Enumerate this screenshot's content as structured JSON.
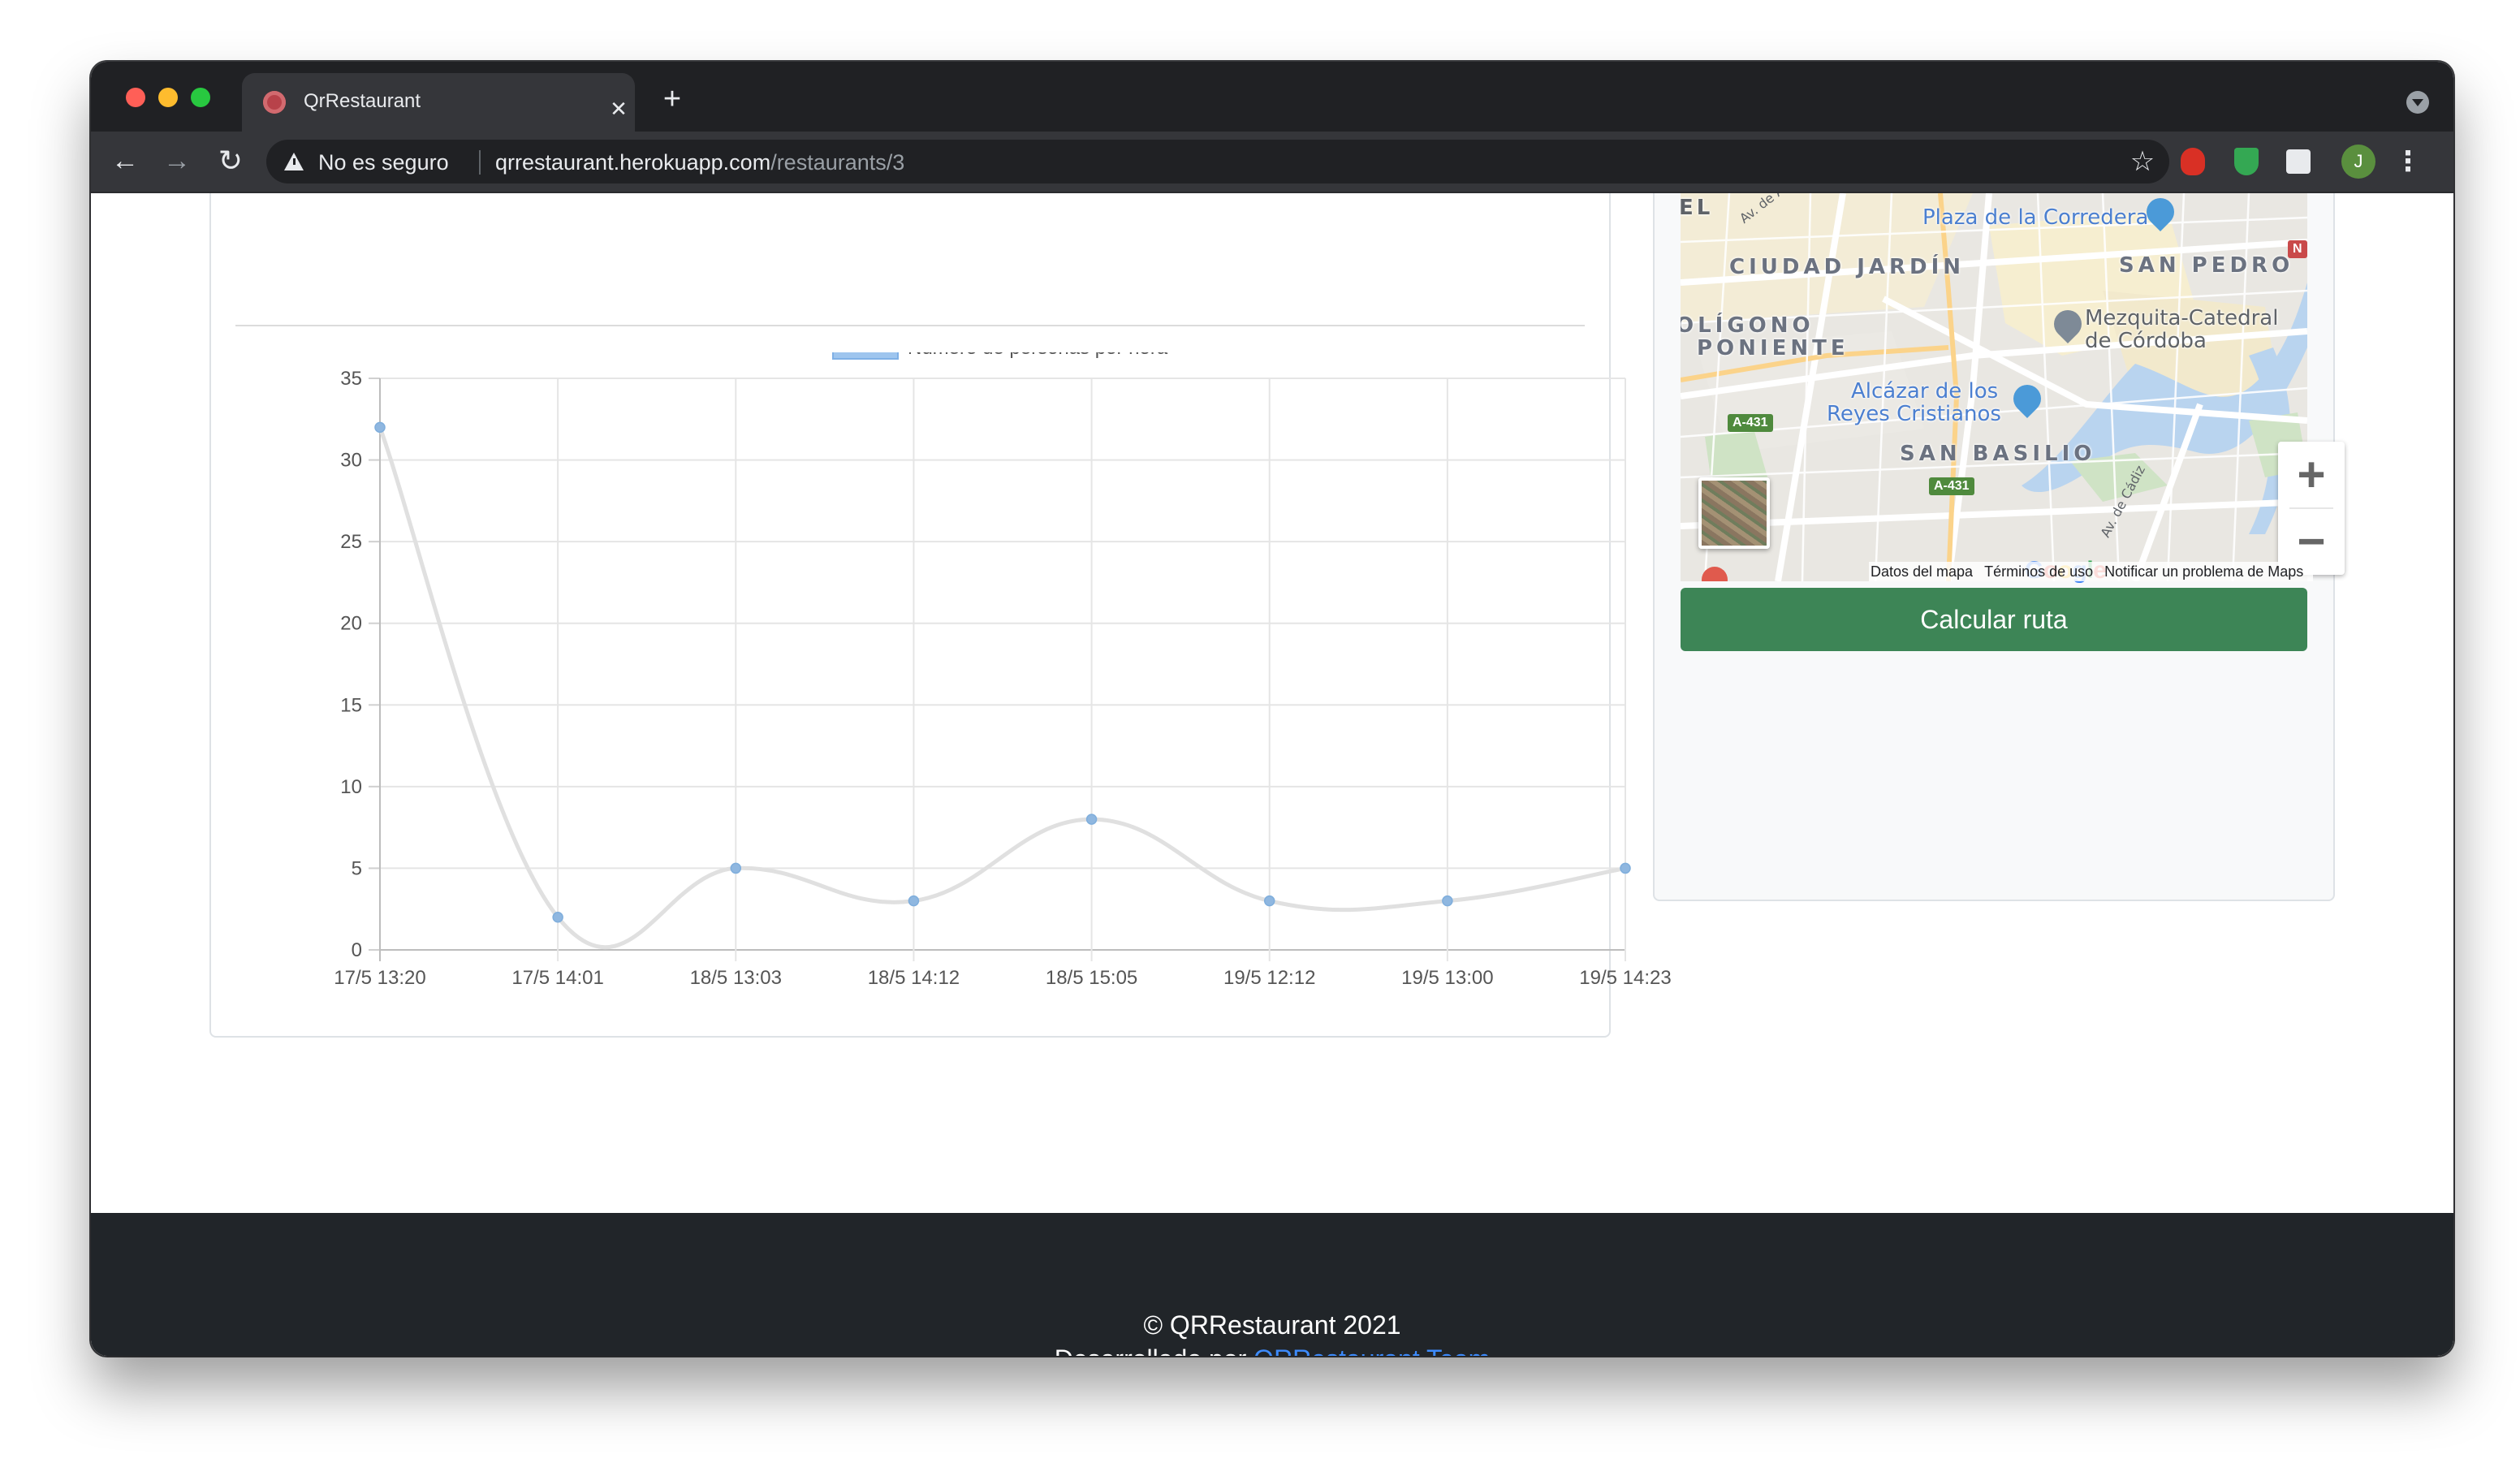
{
  "browser": {
    "tab_title": "QrRestaurant",
    "tab_close": "✕",
    "new_tab": "+",
    "insecure_label": "No es seguro",
    "url_host": "qrrestaurant.herokuapp.com",
    "url_path": "/restaurants/3",
    "avatar_initial": "J",
    "icons": [
      "back-icon",
      "forward-icon",
      "reload-icon",
      "warning-icon",
      "star-icon",
      "extensions-icon",
      "menu-icon"
    ]
  },
  "chart_data": {
    "type": "line",
    "legend_label": "Número de personas por hora",
    "legend_position": "top",
    "categories": [
      "17/5 13:20",
      "17/5 14:01",
      "18/5 13:03",
      "18/5 14:12",
      "18/5 15:05",
      "19/5 12:12",
      "19/5 13:00",
      "19/5 14:23"
    ],
    "series": [
      {
        "name": "Número de personas por hora",
        "values": [
          32,
          2,
          5,
          3,
          8,
          3,
          3,
          5
        ]
      }
    ],
    "ylim": [
      0,
      35
    ],
    "yticks": [
      0,
      5,
      10,
      15,
      20,
      25,
      30,
      35
    ],
    "grid": true,
    "line_color": "#e0e0e0",
    "point_color": "#8fb7e0",
    "legend_fill": "#9ec5ee"
  },
  "map": {
    "labels": {
      "plaza": "Plaza de la Corredera",
      "ciudad_jardin": "CIUDAD JARDÍN",
      "san_pedro": "SAN PEDRO",
      "poligono_1": "OLÍGONO",
      "poligono_2": "PONIENTE",
      "mezquita_1": "Mezquita-Catedral",
      "mezquita_2": "de Córdoba",
      "alcazar_1": "Alcázar de los",
      "alcazar_2": "Reyes Cristianos",
      "san_basilio": "SAN BASILIO",
      "el": "EL",
      "road_1": "A-431",
      "road_2": "A-431",
      "av_cadiz": "Av. de Cádiz",
      "av_top": "Av. de A",
      "north_badge": "N"
    },
    "zoom_in": "+",
    "zoom_out": "−",
    "attribution": [
      "Datos del mapa",
      "Términos de uso",
      "Notificar un problema de Maps"
    ]
  },
  "route_button": "Calcular ruta",
  "footer": {
    "copyright": "© QRRestaurant 2021",
    "developed_prefix": "Desarrollado por",
    "team_link": "QRRestaurant Team"
  }
}
